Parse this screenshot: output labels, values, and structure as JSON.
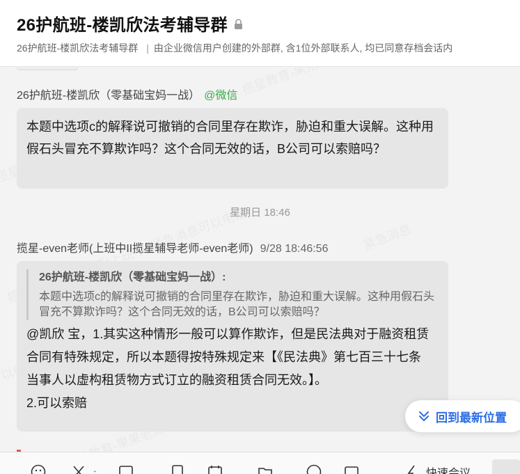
{
  "header": {
    "title": "26护航班-楼凯欣法考辅导群",
    "subtitle_name": "26护航班-楼凯欣法考辅导群",
    "subtitle_separator": "|",
    "subtitle_desc": "由企业微信用户创建的外部群, 含1位外部联系人, 均已同意存档会话内"
  },
  "messages": [
    {
      "sender": "26护航班-楼凯欣（零基础宝妈一战）",
      "source": "@微信",
      "text": "本题中选项c的解释说可撤销的合同里存在欺诈，胁迫和重大误解。这种用假石头冒充不算欺诈吗？这个合同无效的话，B公司可以索赔吗？"
    },
    {
      "sender": "揽星-even老师(上班中II揽星辅导老师-even老师)",
      "time": "9/28 18:46:56",
      "quote_name": "26护航班-楼凯欣（零基础宝妈一战）:",
      "quote_text": "本题中选项c的解释说可撤销的合同里存在欺诈，胁迫和重大误解。这种用假石头冒充不算欺诈吗？这个合同无效的话，B公司可以索赔吗？",
      "text_line1": "@凯欣 宝，1.其实这种情形一般可以算作欺诈，但是民法典对于融资租赁合同有特殊规定，所以本题得按特殊规定来【《民法典》第七百三十七条　当事人以虚构租赁物方式订立的融资租赁合同无效。】。",
      "text_line2": "2.可以索赔"
    }
  ],
  "timestamp_divider": "星期日 18:46",
  "jump_button": {
    "label": "回到最新位置",
    "icon": "chevrons-down-icon"
  },
  "toolbar": {
    "quick_reply_label": "快速会议"
  },
  "colors": {
    "accent": "#2f6fe6",
    "wechat_green": "#3aa84b",
    "bubble": "#e6e6e6",
    "background": "#f3f3f3"
  }
}
